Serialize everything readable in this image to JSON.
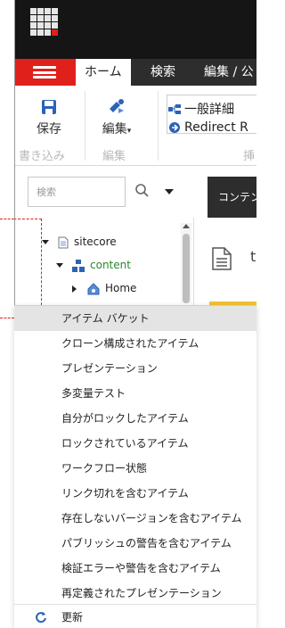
{
  "app": {
    "tabs": [
      {
        "label": "ホーム"
      },
      {
        "label": "検索"
      },
      {
        "label": "編集 / 公"
      }
    ]
  },
  "ribbon": {
    "save_label": "保存",
    "edit_label": "編集",
    "general_label": "一般詳細",
    "redirect_label": "Redirect R",
    "group_write": "書き込み",
    "group_edit": "編集",
    "group_insert": "挿"
  },
  "search": {
    "placeholder": "検索"
  },
  "content_tab": {
    "label": "コンテン"
  },
  "editor": {
    "title": "t"
  },
  "tree": {
    "items": [
      {
        "label": "sitecore"
      },
      {
        "label": "content"
      },
      {
        "label": "Home"
      }
    ]
  },
  "dropdown": {
    "items": [
      {
        "label": "アイテム バケット"
      },
      {
        "label": "クローン構成されたアイテム"
      },
      {
        "label": "プレゼンテーション"
      },
      {
        "label": "多変量テスト"
      },
      {
        "label": "自分がロックしたアイテム"
      },
      {
        "label": "ロックされているアイテム"
      },
      {
        "label": "ワークフロー状態"
      },
      {
        "label": "リンク切れを含むアイテム"
      },
      {
        "label": "存在しないバージョンを含むアイテム"
      },
      {
        "label": "パブリッシュの警告を含むアイテム"
      },
      {
        "label": "検証エラーや警告を含むアイテム"
      },
      {
        "label": "再定義されたプレゼンテーション"
      }
    ],
    "refresh_label": "更新"
  },
  "colors": {
    "accent_red": "#e0201b",
    "dark_bar": "#151515",
    "tab_bar": "#2d2d2d",
    "content_green": "#2a8a2a",
    "icon_blue": "#2b63b5",
    "hover": "#e4e4e4"
  }
}
